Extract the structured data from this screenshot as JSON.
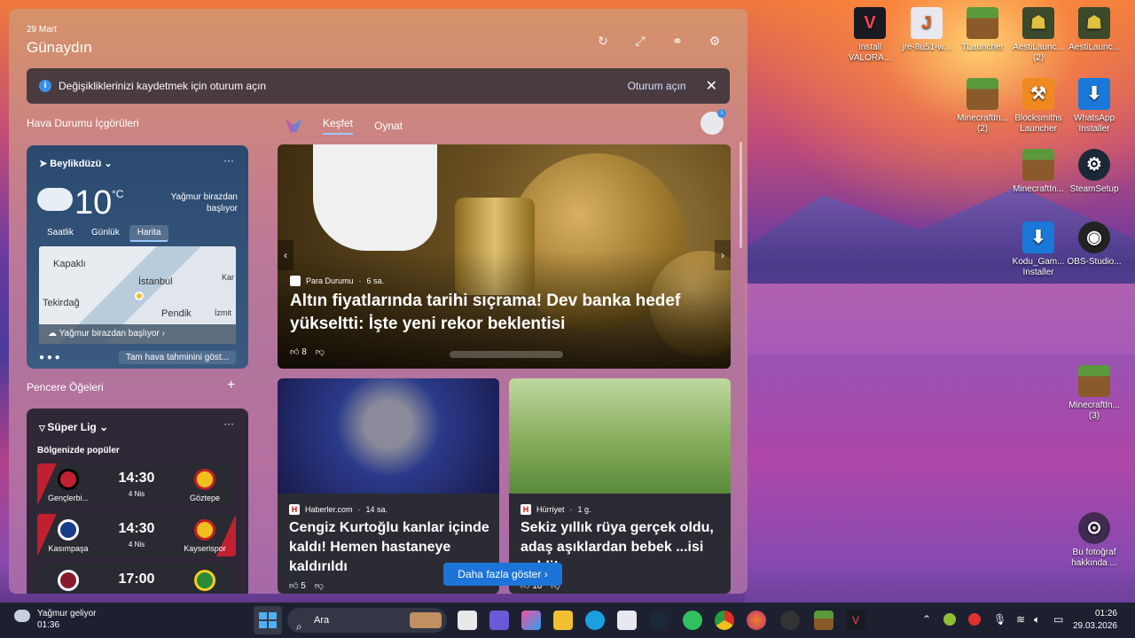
{
  "header": {
    "date": "29 Mart",
    "greeting": "Günaydın"
  },
  "signin": {
    "message": "Değişikliklerinizi kaydetmek için oturum açın",
    "action": "Oturum açın"
  },
  "sections": {
    "weather_insights": "Hava Durumu İçgörüleri",
    "window_items": "Pencere Öğeleri"
  },
  "weather": {
    "location": "Beylikdüzü",
    "temp": "10",
    "unit": "°C",
    "condition": "Yağmur birazdan başlıyor",
    "tabs": [
      "Saatlik",
      "Günlük",
      "Harita"
    ],
    "map_labels": [
      "Kapaklı",
      "İstanbul",
      "Tekirdağ",
      "Pendik",
      "İzmit",
      "Kar"
    ],
    "map_bar": "Yağmur birazdan başlıyor",
    "full_forecast": "Tam hava tahminini göst..."
  },
  "sports": {
    "league": "Süper Lig",
    "subtitle": "Bölgenizde popüler",
    "matches": [
      {
        "home": "Gençlerbi...",
        "away": "Göztepe",
        "time": "14:30",
        "date": "4 Nis"
      },
      {
        "home": "Kasımpaşa",
        "away": "Kayserispor",
        "time": "14:30",
        "date": "4 Nis"
      },
      {
        "home": "",
        "away": "",
        "time": "17:00",
        "date": ""
      }
    ]
  },
  "feed": {
    "tabs": [
      "Keşfet",
      "Oynat"
    ]
  },
  "hero": {
    "source": "Para Durumu",
    "age": "6 sa.",
    "title": "Altın fiyatlarında tarihi sıçrama! Dev banka hedef yükseltti: İşte yeni rekor beklentisi",
    "likes": "8"
  },
  "cards": [
    {
      "source": "Haberler.com",
      "age": "14 sa.",
      "title": "Cengiz Kurtoğlu kanlar içinde kaldı! Hemen hastaneye kaldırıldı",
      "likes": "5"
    },
    {
      "source": "Hürriyet",
      "age": "1 g.",
      "title": "Sekiz yıllık rüya gerçek oldu, adaş aşıklardan bebek ...isi geldi!",
      "likes": "18"
    }
  ],
  "show_more": "Daha fazla göster",
  "desktop_icons": [
    "Install VALORA...",
    "jre-8u51-w...",
    "TLauncher",
    "AestiLaunc... (2)",
    "AestiLaunc...",
    "MinecraftIn... (2)",
    "Blocksmiths Launcher",
    "WhatsApp Installer",
    "MinecraftIn...",
    "SteamSetup",
    "Kodu_Gam... Installer",
    "OBS-Studio...",
    "MinecraftIn... (3)",
    "Bu fotoğraf hakkında ..."
  ],
  "taskbar": {
    "weather_title": "Yağmur geliyor",
    "weather_time": "01:36",
    "search_placeholder": "Ara",
    "time": "01:26",
    "date": "29.03.2026"
  }
}
